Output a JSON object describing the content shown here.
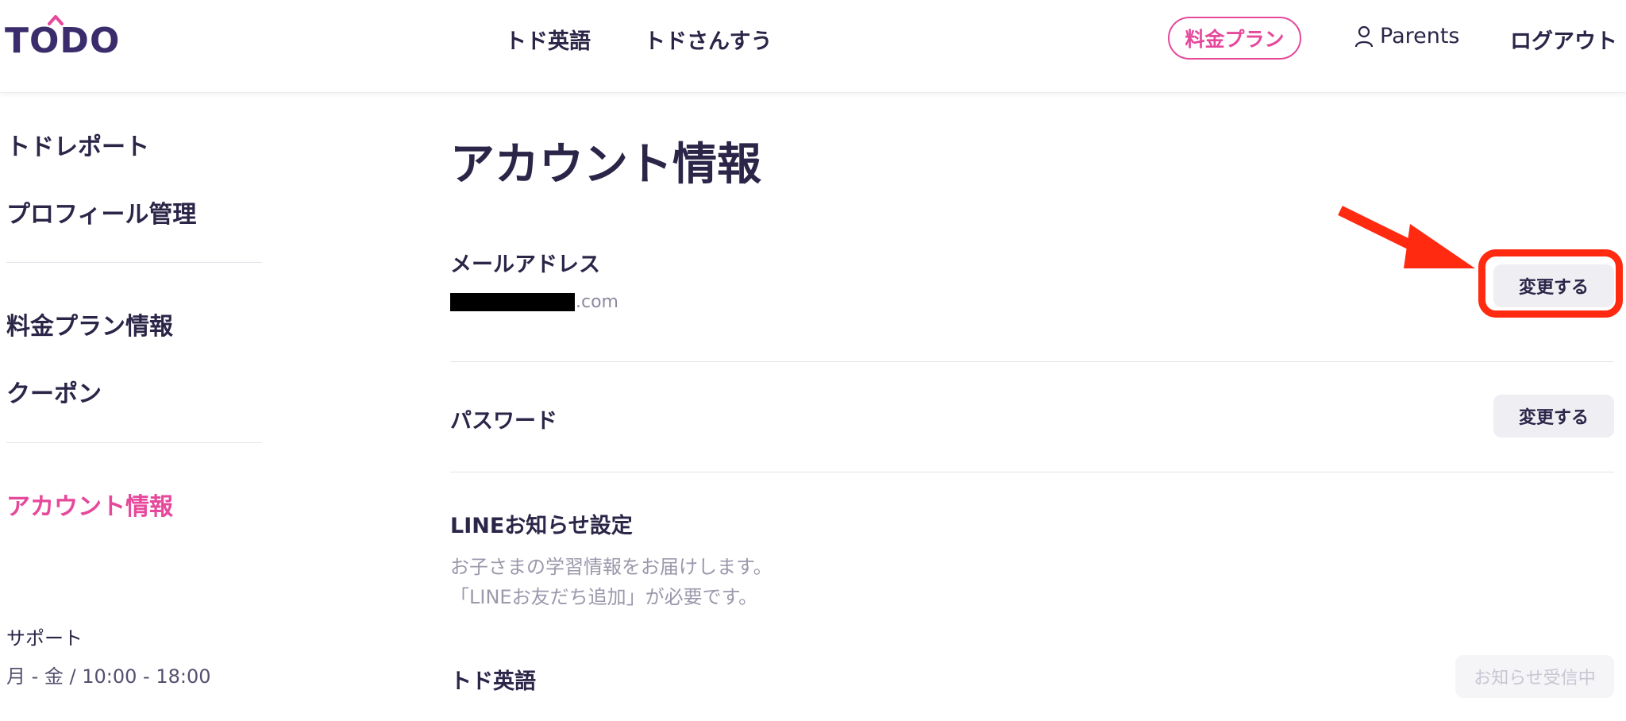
{
  "header": {
    "logo_text": "TODO",
    "nav": [
      {
        "label": "トド英語"
      },
      {
        "label": "トドさんすう"
      }
    ],
    "plan_button": "料金プラン",
    "parents_label": "Parents",
    "logout_label": "ログアウト",
    "accent_color": "#e6489b"
  },
  "sidebar": {
    "items": [
      {
        "label": "トドレポート"
      },
      {
        "label": "プロフィール管理"
      },
      {
        "label": "料金プラン情報"
      },
      {
        "label": "クーポン"
      },
      {
        "label": "アカウント情報",
        "active": true
      }
    ],
    "support_label": "サポート",
    "support_hours": "月 - 金 / 10:00 - 18:00"
  },
  "main": {
    "title": "アカウント情報",
    "email": {
      "label": "メールアドレス",
      "value_suffix": ".com",
      "button": "変更する"
    },
    "password": {
      "label": "パスワード",
      "button": "変更する"
    },
    "line": {
      "label": "LINEお知らせ設定",
      "desc_line1": "お子さまの学習情報をお届けします。",
      "desc_line2": "「LINEお友だち追加」が必要です。"
    },
    "todo_english": {
      "label": "トド英語",
      "button": "お知らせ受信中"
    }
  },
  "annotation": {
    "color": "#ff2a10",
    "target": "email change button"
  }
}
